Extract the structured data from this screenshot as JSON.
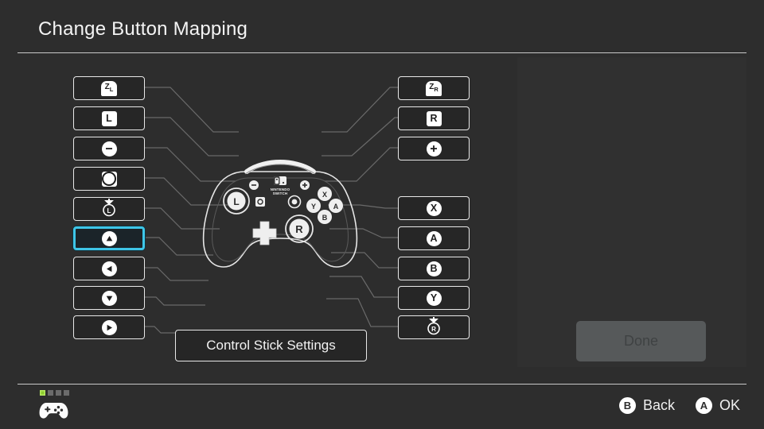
{
  "header": {
    "title": "Change Button Mapping"
  },
  "left_buttons": [
    {
      "name": "zl",
      "label": "ZL",
      "glyph": "shoulder",
      "selected": false
    },
    {
      "name": "l",
      "label": "L",
      "glyph": "square-letter",
      "selected": false
    },
    {
      "name": "minus",
      "label": "−",
      "glyph": "circle",
      "selected": false
    },
    {
      "name": "capture",
      "label": "capture",
      "glyph": "square-circle",
      "selected": false
    },
    {
      "name": "l-stick-press",
      "label": "L",
      "glyph": "stick-press",
      "selected": false
    },
    {
      "name": "dpad-up",
      "label": "▲",
      "glyph": "circle-arrow",
      "selected": true
    },
    {
      "name": "dpad-left",
      "label": "◀",
      "glyph": "circle-arrow",
      "selected": false
    },
    {
      "name": "dpad-down",
      "label": "▼",
      "glyph": "circle-arrow",
      "selected": false
    },
    {
      "name": "dpad-right",
      "label": "▶",
      "glyph": "circle-arrow",
      "selected": false
    }
  ],
  "right_buttons": [
    {
      "name": "zr",
      "label": "ZR",
      "glyph": "shoulder",
      "selected": false
    },
    {
      "name": "r",
      "label": "R",
      "glyph": "square-letter",
      "selected": false
    },
    {
      "name": "plus",
      "label": "+",
      "glyph": "circle",
      "selected": false
    },
    {
      "name": "x",
      "label": "X",
      "glyph": "circle",
      "selected": false
    },
    {
      "name": "a",
      "label": "A",
      "glyph": "circle",
      "selected": false
    },
    {
      "name": "b",
      "label": "B",
      "glyph": "circle",
      "selected": false
    },
    {
      "name": "y",
      "label": "Y",
      "glyph": "circle",
      "selected": false
    },
    {
      "name": "r-stick-press",
      "label": "R",
      "glyph": "stick-press",
      "selected": false
    }
  ],
  "controller": {
    "alt": "nintendo-switch-pro-controller",
    "logo_text": "NINTENDO SWITCH",
    "left_stick_label": "L",
    "right_stick_label": "R",
    "face_buttons": [
      "X",
      "Y",
      "A",
      "B"
    ]
  },
  "stick_settings": {
    "label": "Control Stick Settings"
  },
  "done": {
    "label": "Done",
    "enabled": false
  },
  "footer": {
    "controller_slots": [
      true,
      false,
      false,
      false
    ],
    "hints": [
      {
        "button": "B",
        "label": "Back"
      },
      {
        "button": "A",
        "label": "OK"
      }
    ]
  },
  "colors": {
    "background": "#2d2d2d",
    "panel": "#303030",
    "button_fill": "#262626",
    "button_border": "#e8e8e8",
    "selected_border": "#3ec6e8",
    "selected_fill": "#1b2429",
    "wire": "#6a6a6a",
    "done_fill": "#56595a",
    "done_text": "#3f4243",
    "slot_active": "#8ccc2c",
    "slot_inactive": "#6b6b6b"
  }
}
